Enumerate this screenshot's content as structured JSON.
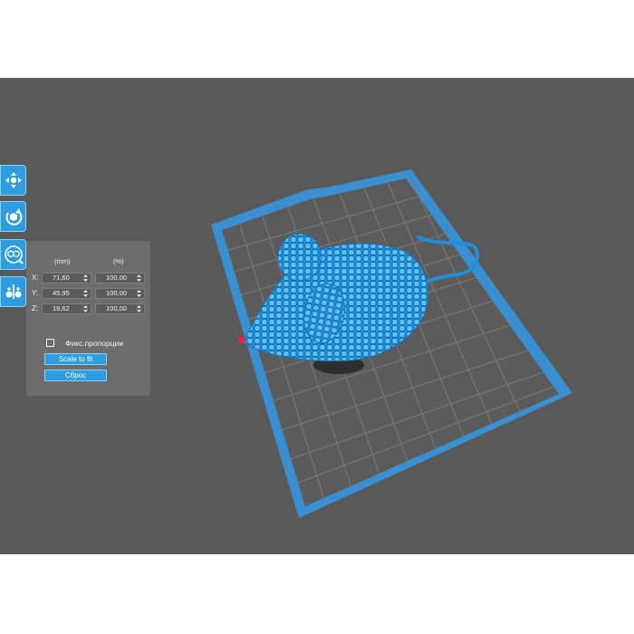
{
  "colors": {
    "viewport_bg": "#595959",
    "accent": "#2e9de0",
    "plate_border": "#3a8fd0",
    "plate_fill": "#5a5a5a",
    "model": "#1e8fd8",
    "panel_bg": "#6d6d6d"
  },
  "toolbar": {
    "items": [
      {
        "name": "move-tool",
        "icon": "move-arrows-icon"
      },
      {
        "name": "rotate-tool",
        "icon": "rotate-cube-icon"
      },
      {
        "name": "scale-tool",
        "icon": "scale-cube-icon"
      },
      {
        "name": "mirror-tool",
        "icon": "mirror-icon"
      }
    ]
  },
  "scale_panel": {
    "col_mm": "(mm)",
    "col_pct": "(%)",
    "rows": [
      {
        "axis": "X:",
        "mm": "71,60",
        "pct": "100,00"
      },
      {
        "axis": "Y:",
        "mm": "45,95",
        "pct": "100,00"
      },
      {
        "axis": "Z:",
        "mm": "19,62",
        "pct": "100,00"
      }
    ],
    "lock_label": "Фикс.пропорции",
    "lock_checked": false,
    "scale_to_fit": "Scale to fit",
    "reset": "Сброс"
  }
}
